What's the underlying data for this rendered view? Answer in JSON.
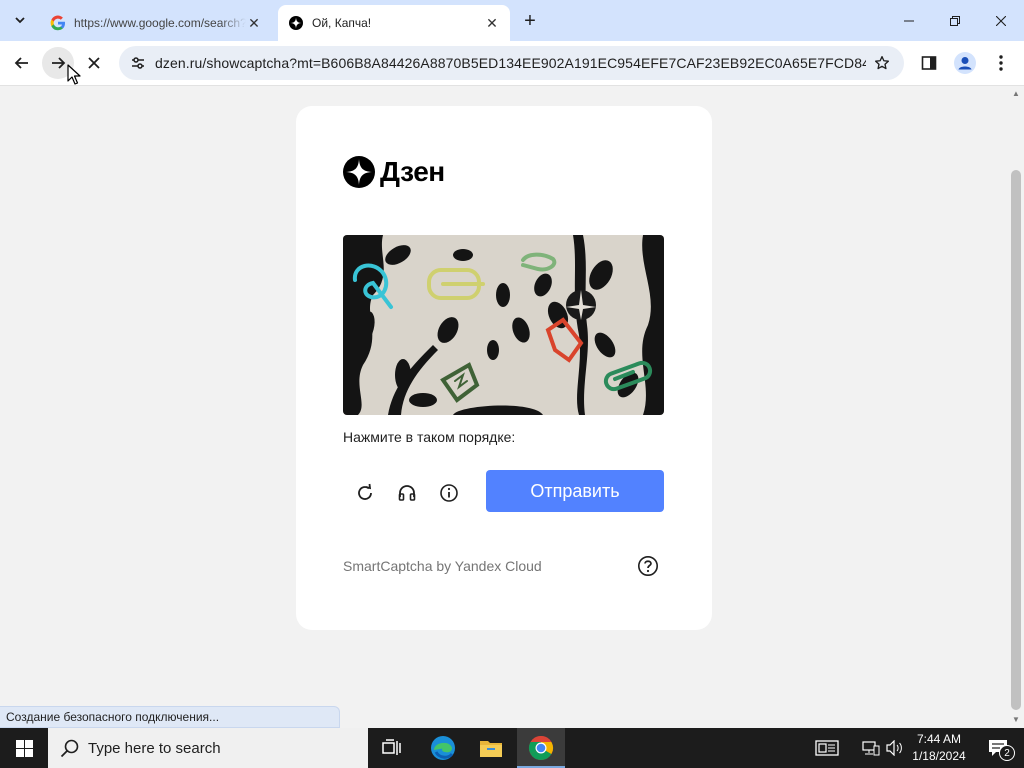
{
  "browser": {
    "tabs": [
      {
        "title": "https://www.google.com/search?",
        "favicon": "google-g-icon",
        "active": false
      },
      {
        "title": "Ой, Капча!",
        "favicon": "dzen-logo-icon",
        "active": true
      }
    ],
    "address_bar": {
      "url": "dzen.ru/showcaptcha?mt=B606B8A84426A8870B5ED134EE902A191EC954EFE7CAF23EB92EC0A65E7FCD84B6148..."
    },
    "status_text": "Создание безопасного подключения..."
  },
  "page": {
    "brand": {
      "name": "Дзен"
    },
    "captcha": {
      "instruction": "Нажмите в таком порядке:",
      "submit_label": "Отправить",
      "footer": "SmartCaptcha by Yandex Cloud",
      "actions": [
        "refresh-icon",
        "audio-headphones-icon",
        "info-icon"
      ]
    },
    "colors": {
      "submit": "#5282ff",
      "card": "#ffffff",
      "background": "#f2f2f2"
    }
  },
  "taskbar": {
    "search_placeholder": "Type here to search",
    "time": "7:44 AM",
    "date": "1/18/2024",
    "notification_count": "2"
  }
}
